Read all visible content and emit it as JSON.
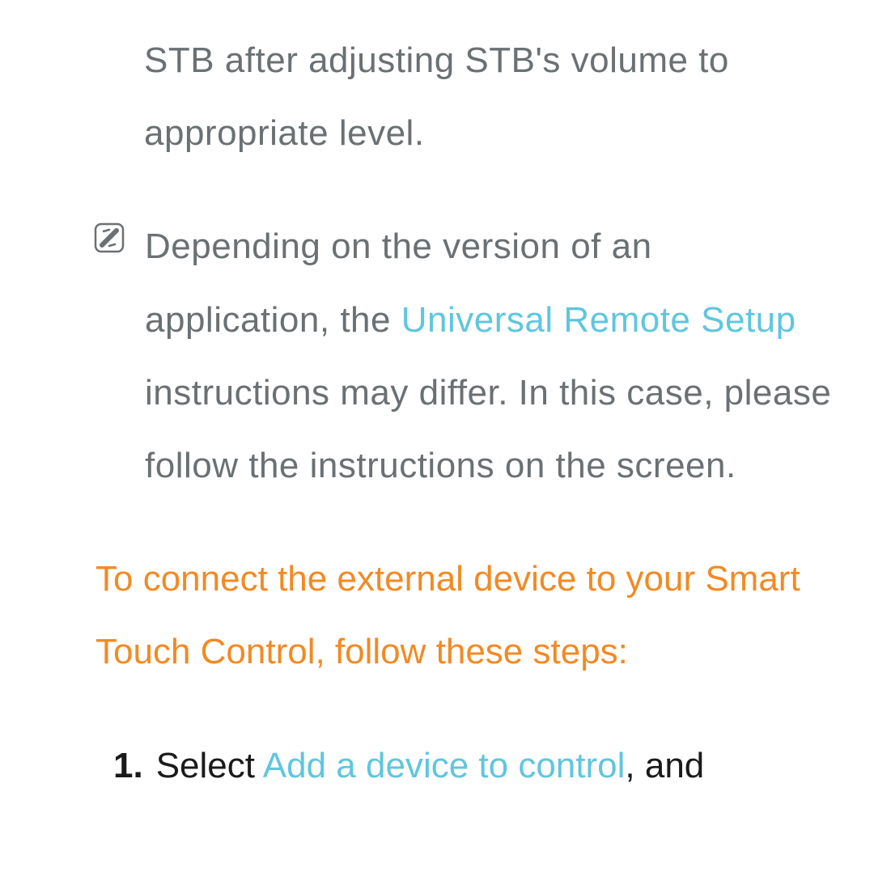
{
  "para1": "STB after adjusting STB's volume to appropriate level.",
  "note": {
    "pre": "Depending on the version of an application, the ",
    "link": "Universal Remote Setup",
    "post": " instructions may differ. In this case, please follow the instructions on the screen."
  },
  "heading": "To connect the external device to your Smart Touch Control, follow these steps:",
  "step1": {
    "num": "1.",
    "pre": "Select ",
    "link": "Add a device to control",
    "post": ", and"
  }
}
